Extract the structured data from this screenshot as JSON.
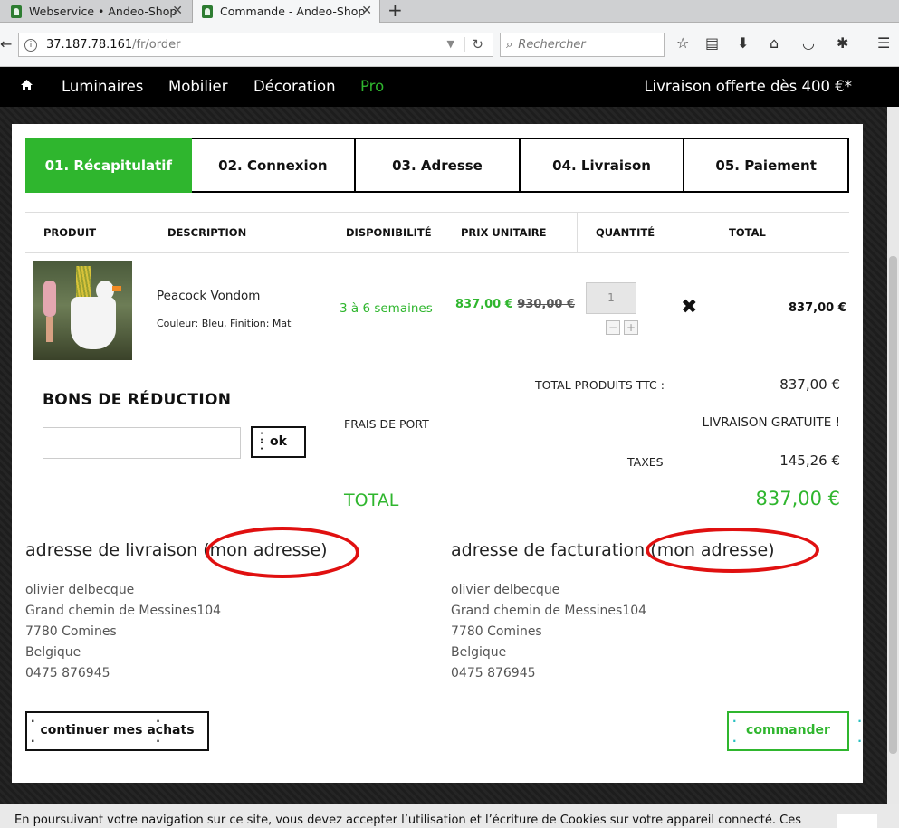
{
  "browser": {
    "tabs": [
      {
        "title": "Webservice • Andeo-Shop"
      },
      {
        "title": "Commande - Andeo-Shop"
      }
    ],
    "url_host": "37.187.78.161",
    "url_path": "/fr/order",
    "search_placeholder": "Rechercher"
  },
  "site_nav": {
    "items": [
      "Luminaires",
      "Mobilier",
      "Décoration",
      "Pro"
    ],
    "promo": "Livraison offerte dès 400 €*"
  },
  "steps": [
    "01. Récapitulatif",
    "02. Connexion",
    "03. Adresse",
    "04. Livraison",
    "05. Paiement"
  ],
  "table": {
    "headers": [
      "PRODUIT",
      "DESCRIPTION",
      "DISPONIBILITÉ",
      "PRIX UNITAIRE",
      "QUANTITÉ",
      "TOTAL"
    ],
    "row": {
      "name": "Peacock Vondom",
      "attributes": "Couleur: Bleu, Finition: Mat",
      "availability": "3 à 6 semaines",
      "price_new": "837,00 €",
      "price_old": "930,00 €",
      "quantity": "1",
      "total": "837,00 €"
    }
  },
  "vouchers": {
    "title": "BONS DE RÉDUCTION",
    "button": "ok"
  },
  "summary": {
    "products_label": "TOTAL PRODUITS TTC :",
    "products_value": "837,00 €",
    "shipping_label": "FRAIS DE PORT",
    "shipping_value": "LIVRAISON GRATUITE !",
    "taxes_label": "TAXES",
    "taxes_value": "145,26 €",
    "total_label": "TOTAL",
    "total_value": "837,00 €"
  },
  "delivery_address": {
    "title": "adresse de livraison",
    "alias": "(mon adresse)",
    "lines": [
      "olivier delbecque",
      "Grand chemin de Messines104",
      "7780 Comines",
      "Belgique",
      "0475 876945"
    ]
  },
  "billing_address": {
    "title": "adresse de facturation",
    "alias": "(mon adresse)",
    "lines": [
      "olivier delbecque",
      "Grand chemin de Messines104",
      "7780 Comines",
      "Belgique",
      "0475 876945"
    ]
  },
  "actions": {
    "continue": "continuer mes achats",
    "order": "commander"
  },
  "cookie_text": "En poursuivant votre navigation sur ce site, vous devez accepter l’utilisation et l’écriture de Cookies sur votre appareil connecté. Ces",
  "colors": {
    "accent": "#2fb62e",
    "annotation": "#e01010"
  }
}
